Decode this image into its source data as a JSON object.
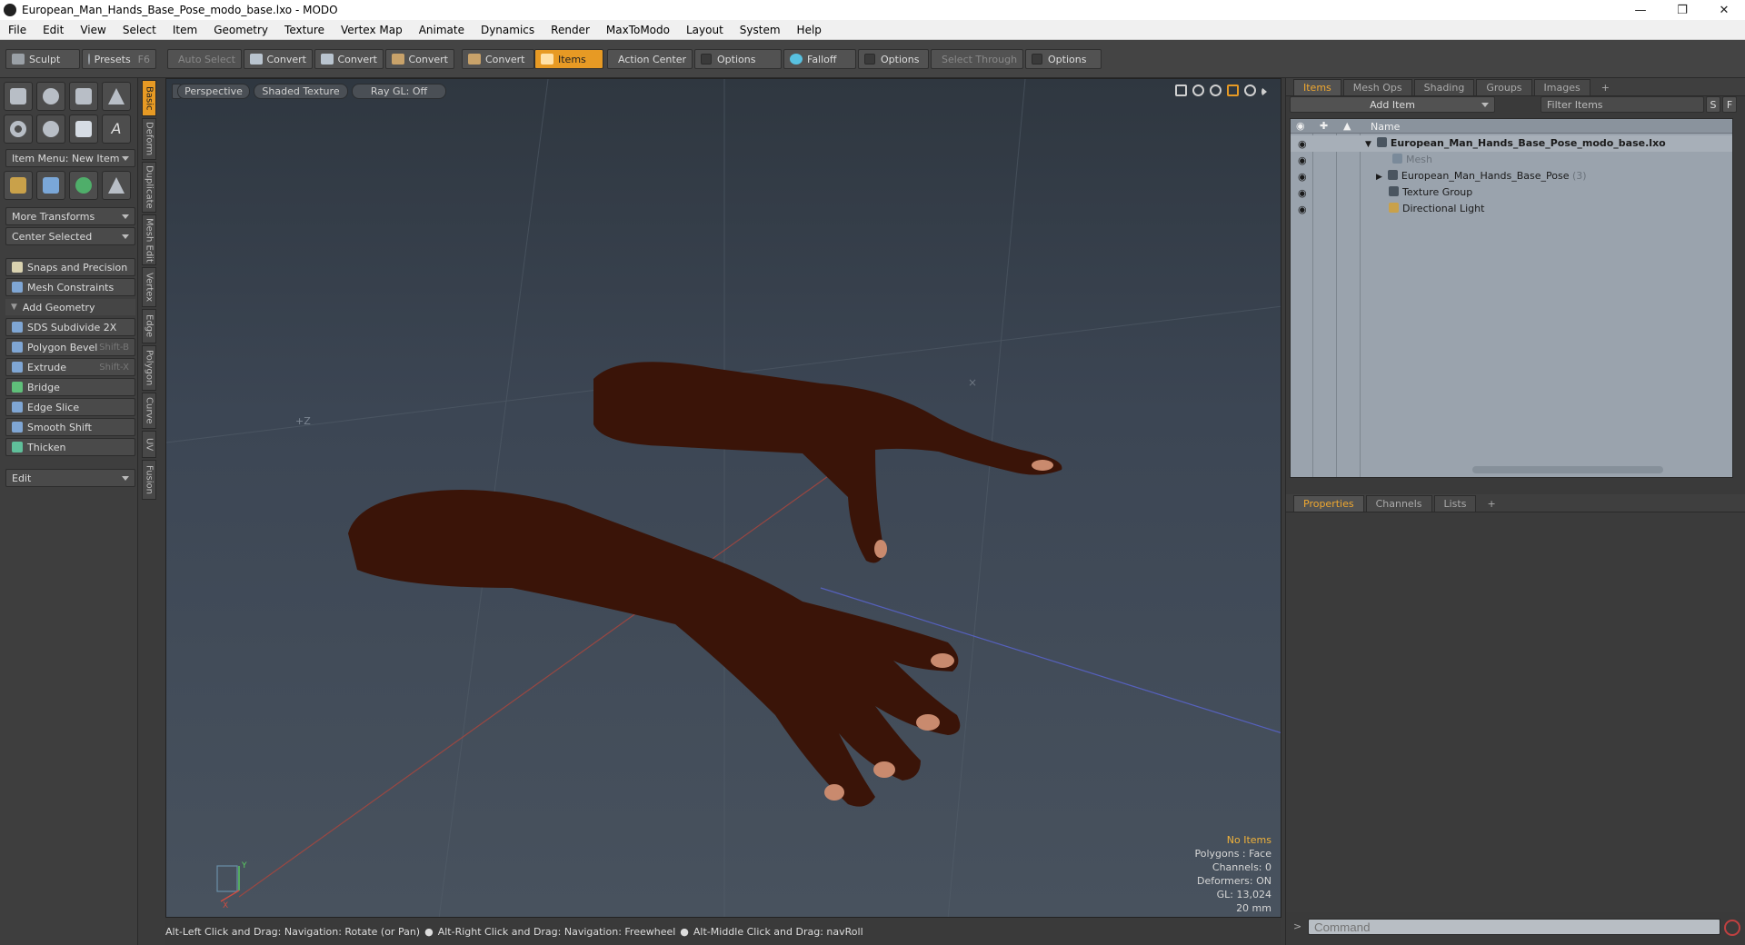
{
  "window": {
    "title": "European_Man_Hands_Base_Pose_modo_base.lxo - MODO",
    "min": "—",
    "restore": "❐",
    "close": "✕"
  },
  "menu": [
    "File",
    "Edit",
    "View",
    "Select",
    "Item",
    "Geometry",
    "Texture",
    "Vertex Map",
    "Animate",
    "Dynamics",
    "Render",
    "MaxToModo",
    "Layout",
    "System",
    "Help"
  ],
  "toolbar": {
    "sculpt": "Sculpt",
    "presets": "Presets",
    "presets_key": "F6",
    "auto_select": "Auto Select",
    "convert1": "Convert",
    "convert2": "Convert",
    "convert3": "Convert",
    "convert4": "Convert",
    "items": "Items",
    "action_center": "Action Center",
    "options1": "Options",
    "falloff": "Falloff",
    "options2": "Options",
    "select_through": "Select Through",
    "options3": "Options"
  },
  "left": {
    "item_menu": "Item Menu: New Item",
    "more_transforms": "More Transforms",
    "center_selected": "Center Selected",
    "snaps": "Snaps and Precision",
    "mesh_constraints": "Mesh Constraints",
    "add_geometry": "Add Geometry",
    "tools": [
      {
        "label": "SDS Subdivide 2X",
        "key": ""
      },
      {
        "label": "Polygon Bevel",
        "key": "Shift-B"
      },
      {
        "label": "Extrude",
        "key": "Shift-X"
      },
      {
        "label": "Bridge",
        "key": ""
      },
      {
        "label": "Edge Slice",
        "key": ""
      },
      {
        "label": "Smooth Shift",
        "key": ""
      },
      {
        "label": "Thicken",
        "key": ""
      }
    ],
    "edit": "Edit"
  },
  "vtabs": [
    "Basic",
    "Deform",
    "Duplicate",
    "Mesh Edit",
    "Vertex",
    "Edge",
    "Polygon",
    "Curve",
    "UV",
    "Fusion"
  ],
  "viewport": {
    "perspective": "Perspective",
    "shaded": "Shaded Texture",
    "raygl": "Ray GL: Off",
    "readout": {
      "no_items": "No Items",
      "polygons": "Polygons : Face",
      "channels": "Channels: 0",
      "deformers": "Deformers: ON",
      "gl": "GL: 13,024",
      "scale": "20 mm"
    },
    "axis_labels": {
      "y": "Y",
      "x": "X",
      "z": "Z",
      "plus_z": "+Z"
    },
    "skin_color": "#3a1408",
    "nail_color": "#c98a6e"
  },
  "status": {
    "hint1": "Alt-Left Click and Drag: Navigation: Rotate (or Pan)",
    "hint2": "Alt-Right Click and Drag: Navigation: Freewheel",
    "hint3": "Alt-Middle Click and Drag: navRoll"
  },
  "right": {
    "tabs_top": [
      "Items",
      "Mesh Ops",
      "Shading",
      "Groups",
      "Images"
    ],
    "add_item": "Add Item",
    "filter_items": "Filter Items",
    "s_btn": "S",
    "f_btn": "F",
    "col_name": "Name",
    "tree": [
      {
        "label": "European_Man_Hands_Base_Pose_modo_base.lxo",
        "indent": 0,
        "bold": true
      },
      {
        "label": "Mesh",
        "indent": 2,
        "muted": true
      },
      {
        "label": "European_Man_Hands_Base_Pose",
        "count": "(3)",
        "indent": 1
      },
      {
        "label": "Texture Group",
        "indent": 1
      },
      {
        "label": "Directional Light",
        "indent": 1
      }
    ],
    "tabs_bottom": [
      "Properties",
      "Channels",
      "Lists"
    ],
    "command_placeholder": "Command",
    "accent": "#f0a830"
  }
}
